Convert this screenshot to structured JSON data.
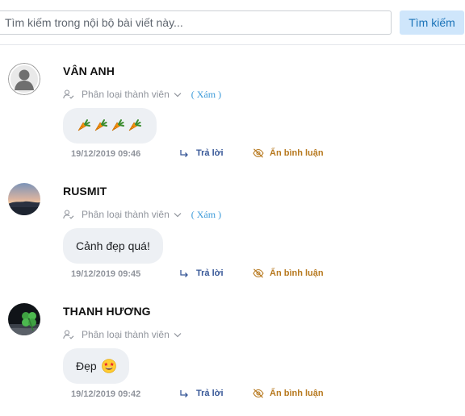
{
  "search": {
    "placeholder": "Tìm kiếm trong nội bộ bài viết này...",
    "button_label": "Tìm kiếm"
  },
  "comments": [
    {
      "author": "VÂN ANH",
      "member_label": "Phân loại thành viên",
      "view_label": "( Xám )",
      "text": "",
      "emoji": [
        "carrot-emoji",
        "carrot-emoji",
        "carrot-emoji",
        "carrot-emoji"
      ],
      "timestamp": "19/12/2019 09:46",
      "reply_label": "Trả lời",
      "hide_label": "Ẩn bình luận",
      "avatar": "default-user-avatar"
    },
    {
      "author": "RUSMIT",
      "member_label": "Phân loại thành viên",
      "view_label": "( Xám )",
      "text": "Cảnh đẹp quá!",
      "timestamp": "19/12/2019 09:45",
      "reply_label": "Trả lời",
      "hide_label": "Ẩn bình luận",
      "avatar": "sunset-landscape-avatar"
    },
    {
      "author": "THANH HƯƠNG",
      "member_label": "Phân loại thành viên",
      "view_label": "",
      "text": "Đẹp",
      "emoji": [
        "star-struck-emoji"
      ],
      "timestamp": "19/12/2019 09:42",
      "reply_label": "Trả lời",
      "hide_label": "Ẩn bình luận",
      "avatar": "four-leaf-clover-avatar"
    }
  ],
  "colors": {
    "accent": "#1a73b8",
    "search_button_bg": "#cfe6fb",
    "reply": "#385898",
    "hide": "#b7791f",
    "muted": "#90949c",
    "bubble_bg": "#edf0f4",
    "view_link": "#3b9ad9"
  }
}
